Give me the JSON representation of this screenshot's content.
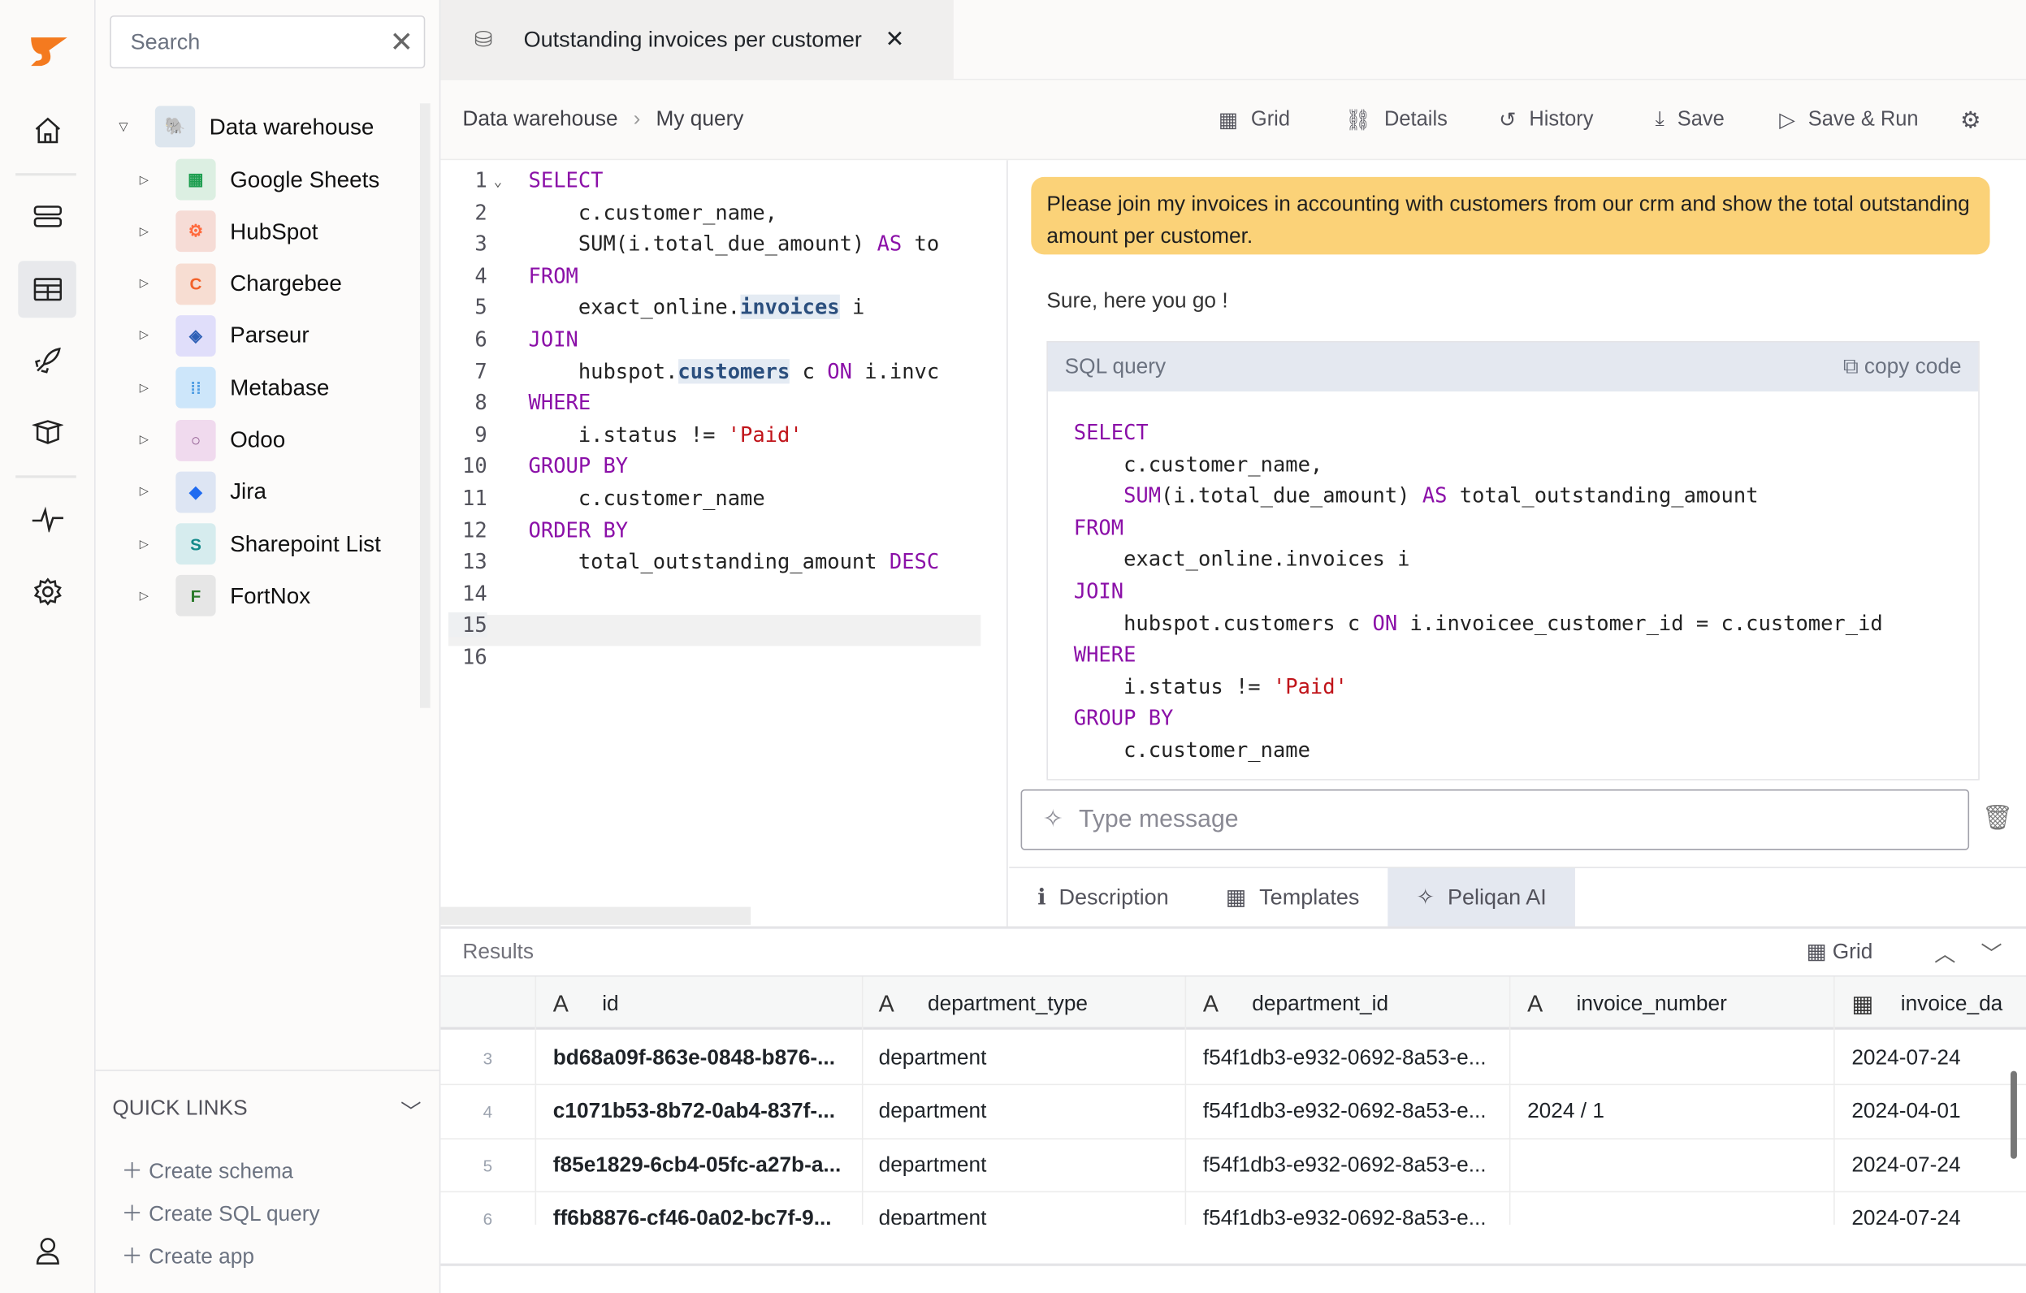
{
  "rail": {
    "icons": [
      "pelican-logo-icon",
      "home-icon",
      "database-icon",
      "table-icon",
      "rocket-icon",
      "box-icon",
      "activity-icon",
      "gear-icon",
      "user-icon"
    ]
  },
  "sidebar": {
    "search_placeholder": "Search",
    "root": "Data warehouse",
    "items": [
      {
        "label": "Google Sheets",
        "color": "#1e9e50",
        "bg": "#dcefe2",
        "glyph": "▦"
      },
      {
        "label": "HubSpot",
        "color": "#ff6a3d",
        "bg": "#f6dcd6",
        "glyph": "⚙"
      },
      {
        "label": "Chargebee",
        "color": "#f2622a",
        "bg": "#f7ddd2",
        "glyph": "C"
      },
      {
        "label": "Parseur",
        "color": "#2d5fb5",
        "bg": "#e0defa",
        "glyph": "◈"
      },
      {
        "label": "Metabase",
        "color": "#509ee3",
        "bg": "#cde6fa",
        "glyph": "⁞⁞"
      },
      {
        "label": "Odoo",
        "color": "#8f5a8f",
        "bg": "#f0daee",
        "glyph": "○"
      },
      {
        "label": "Jira",
        "color": "#1f6bf0",
        "bg": "#dde5f3",
        "glyph": "◆"
      },
      {
        "label": "Sharepoint List",
        "color": "#138a8a",
        "bg": "#d6ecee",
        "glyph": "S"
      },
      {
        "label": "FortNox",
        "color": "#2b7a2b",
        "bg": "#e6e6e6",
        "glyph": "F"
      }
    ],
    "quick_links": {
      "title": "QUICK LINKS",
      "items": [
        "Create schema",
        "Create SQL query",
        "Create app"
      ]
    }
  },
  "tab": {
    "title": "Outstanding invoices per customer"
  },
  "breadcrumb": [
    "Data warehouse",
    "My query"
  ],
  "toolbar": {
    "grid": "Grid",
    "details": "Details",
    "history": "History",
    "save": "Save",
    "save_run": "Save & Run"
  },
  "editor": {
    "lines": [
      [
        [
          "kw",
          "SELECT"
        ]
      ],
      [
        [
          "",
          "    c.customer_name,"
        ]
      ],
      [
        [
          "",
          "    SUM(i.total_due_amount) "
        ],
        [
          "kw",
          "AS"
        ],
        [
          "",
          " to"
        ]
      ],
      [
        [
          "kw",
          "FROM"
        ]
      ],
      [
        [
          "",
          "    exact_online."
        ],
        [
          "hl",
          "invoices"
        ],
        [
          "",
          " i"
        ]
      ],
      [
        [
          "kw",
          "JOIN"
        ]
      ],
      [
        [
          "",
          "    hubspot."
        ],
        [
          "hl",
          "customers"
        ],
        [
          "",
          " c "
        ],
        [
          "kw",
          "ON"
        ],
        [
          "",
          " i.invc"
        ]
      ],
      [
        [
          "kw",
          "WHERE"
        ]
      ],
      [
        [
          "",
          "    i.status != "
        ],
        [
          "str",
          "'Paid'"
        ]
      ],
      [
        [
          "kw",
          "GROUP BY"
        ]
      ],
      [
        [
          "",
          "    c.customer_name"
        ]
      ],
      [
        [
          "kw",
          "ORDER BY"
        ]
      ],
      [
        [
          "",
          "    total_outstanding_amount "
        ],
        [
          "kw",
          "DESC"
        ]
      ],
      [],
      [],
      []
    ]
  },
  "chat": {
    "user_message": "Please join my invoices in accounting with customers from our crm and show the total outstanding amount per customer.",
    "reply": "Sure, here you go !",
    "sql_label": "SQL query",
    "copy_label": "copy code",
    "sql_lines": [
      [
        [
          "kw",
          "SELECT"
        ]
      ],
      [
        [
          "",
          "    c.customer_name,"
        ]
      ],
      [
        [
          "kw",
          "    SUM"
        ],
        [
          "",
          "(i.total_due_amount) "
        ],
        [
          "kw",
          "AS"
        ],
        [
          "",
          " total_outstanding_amount"
        ]
      ],
      [
        [
          "kw",
          "FROM"
        ]
      ],
      [
        [
          "",
          "    exact_online.invoices i"
        ]
      ],
      [
        [
          "kw",
          "JOIN"
        ]
      ],
      [
        [
          "",
          "    hubspot.customers c "
        ],
        [
          "kw",
          "ON"
        ],
        [
          "",
          " i.invoicee_customer_id = c.customer_id"
        ]
      ],
      [
        [
          "kw",
          "WHERE"
        ]
      ],
      [
        [
          "",
          "    i.status != "
        ],
        [
          "str",
          "'Paid'"
        ]
      ],
      [
        [
          "kw",
          "GROUP BY"
        ]
      ],
      [
        [
          "",
          "    c.customer_name"
        ]
      ]
    ],
    "input_placeholder": "Type message"
  },
  "bottom_tabs": [
    "Description",
    "Templates",
    "Peliqan AI"
  ],
  "results": {
    "title": "Results",
    "view": "Grid",
    "columns": [
      {
        "name": "id",
        "type": "A"
      },
      {
        "name": "department_type",
        "type": "A"
      },
      {
        "name": "department_id",
        "type": "A"
      },
      {
        "name": "invoice_number",
        "type": "A"
      },
      {
        "name": "invoice_da",
        "type": "calendar"
      }
    ],
    "rows": [
      [
        "3",
        "bd68a09f-863e-0848-b876-...",
        "department",
        "f54f1db3-e932-0692-8a53-e...",
        "",
        "2024-07-24"
      ],
      [
        "4",
        "c1071b53-8b72-0ab4-837f-...",
        "department",
        "f54f1db3-e932-0692-8a53-e...",
        "2024 / 1",
        "2024-04-01"
      ],
      [
        "5",
        "f85e1829-6cb4-05fc-a27b-a...",
        "department",
        "f54f1db3-e932-0692-8a53-e...",
        "",
        "2024-07-24"
      ],
      [
        "6",
        "ff6b8876-cf46-0a02-bc7f-9...",
        "department",
        "f54f1db3-e932-0692-8a53-e...",
        "",
        "2024-07-24"
      ]
    ]
  }
}
